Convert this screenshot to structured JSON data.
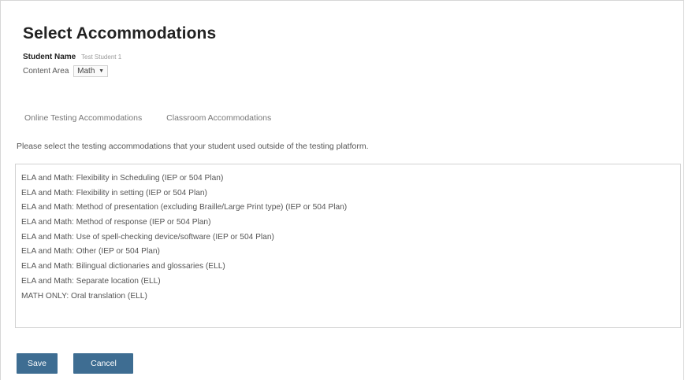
{
  "header": {
    "title": "Select Accommodations",
    "student_label": "Student Name",
    "student_value": "Test Student 1",
    "content_area_label": "Content Area",
    "content_area_value": "Math"
  },
  "tabs": [
    {
      "label": "Online Testing Accommodations"
    },
    {
      "label": "Classroom Accommodations"
    }
  ],
  "instructions": "Please select the testing accommodations that your student used outside of the testing platform.",
  "accommodations": [
    "ELA and Math: Flexibility in Scheduling (IEP or 504 Plan)",
    "ELA and Math: Flexibility in setting (IEP or 504 Plan)",
    "ELA and Math: Method of presentation (excluding Braille/Large Print type) (IEP or 504 Plan)",
    "ELA and Math: Method of response (IEP or 504 Plan)",
    "ELA and Math: Use of spell-checking device/software (IEP or 504 Plan)",
    "ELA and Math: Other (IEP or 504 Plan)",
    "ELA and Math: Bilingual dictionaries and glossaries (ELL)",
    "ELA and Math: Separate location (ELL)",
    "MATH ONLY: Oral translation (ELL)"
  ],
  "buttons": {
    "save_label": "Save",
    "cancel_label": "Cancel"
  },
  "colors": {
    "button_bg": "#3e6d92",
    "button_text": "#ffffff"
  }
}
